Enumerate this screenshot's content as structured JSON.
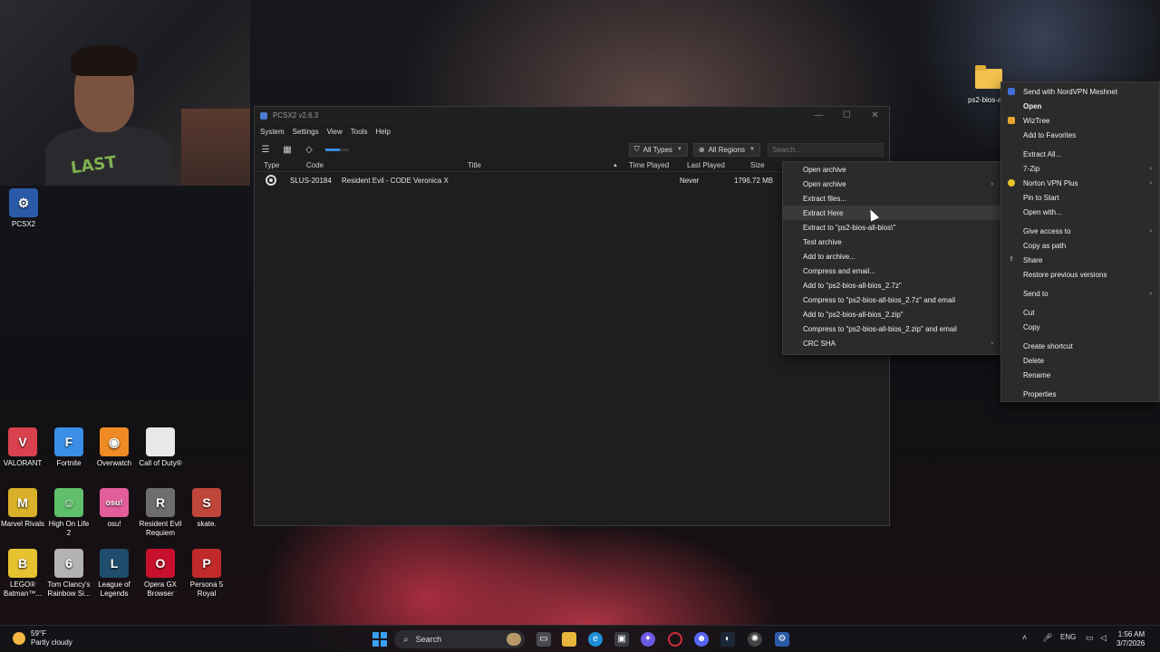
{
  "pcsx2": {
    "title": "PCSX2 v2.6.3",
    "menus": [
      "System",
      "Settings",
      "View",
      "Tools",
      "Help"
    ],
    "filters": {
      "types": "All Types",
      "regions": "All Regions",
      "search_placeholder": "Search..."
    },
    "columns": {
      "type": "Type",
      "code": "Code",
      "title": "Title",
      "time_played": "Time Played",
      "last_played": "Last Played",
      "size": "Size"
    },
    "games": [
      {
        "code": "SLUS-20184",
        "title": "Resident Evil - CODE Veronica X",
        "time_played": "",
        "last_played": "Never",
        "size": "1796.72 MB"
      }
    ]
  },
  "zip_menu": {
    "items": [
      {
        "label": "Open archive"
      },
      {
        "label": "Open archive",
        "submenu": true
      },
      {
        "label": "Extract files..."
      },
      {
        "label": "Extract Here"
      },
      {
        "label": "Extract to \"ps2-bios-all-bios\\\""
      },
      {
        "label": "Test archive"
      },
      {
        "label": "Add to archive..."
      },
      {
        "label": "Compress and email..."
      },
      {
        "label": "Add to \"ps2-bios-all-bios_2.7z\""
      },
      {
        "label": "Compress to \"ps2-bios-all-bios_2.7z\" and email"
      },
      {
        "label": "Add to \"ps2-bios-all-bios_2.zip\""
      },
      {
        "label": "Compress to \"ps2-bios-all-bios_2.zip\" and email"
      },
      {
        "label": "CRC SHA",
        "submenu": true
      }
    ]
  },
  "explorer_menu": {
    "items": [
      {
        "label": "Send with NordVPN Meshnet",
        "icon": "nordvpn-icon"
      },
      {
        "label": "Open",
        "bold": true
      },
      {
        "label": "WizTree",
        "icon": "wiztree-icon"
      },
      {
        "label": "Add to Favorites"
      },
      {
        "label": "Extract All..."
      },
      {
        "label": "7-Zip",
        "submenu": true
      },
      {
        "label": "Norton VPN Plus",
        "icon": "norton-icon",
        "submenu": true
      },
      {
        "label": "Pin to Start"
      },
      {
        "label": "Open with..."
      },
      {
        "label": "Give access to",
        "submenu": true
      },
      {
        "label": "Copy as path"
      },
      {
        "label": "Share",
        "icon": "share-icon"
      },
      {
        "label": "Restore previous versions"
      },
      {
        "label": "Send to",
        "submenu": true
      },
      {
        "label": "Cut"
      },
      {
        "label": "Copy"
      },
      {
        "label": "Create shortcut"
      },
      {
        "label": "Delete"
      },
      {
        "label": "Rename"
      },
      {
        "label": "Properties"
      }
    ]
  },
  "desktop": {
    "folder_label": "ps2-bios-a",
    "pcsx2_icon": "PCSX2",
    "icons": [
      {
        "label": "VALORANT",
        "color": "#d9414e",
        "glyph": "V"
      },
      {
        "label": "Fortnite",
        "color": "#3a8ee6",
        "glyph": "F"
      },
      {
        "label": "Overwatch",
        "color": "#f08a24",
        "glyph": "◉"
      },
      {
        "label": "Call of Duty®",
        "color": "#e8e8e8",
        "glyph": ""
      },
      {
        "label": "Marvel Rivals",
        "color": "#d8b02a",
        "glyph": "M"
      },
      {
        "label": "High On Life 2",
        "color": "#5fbf6b",
        "glyph": "☺"
      },
      {
        "label": "osu!",
        "color": "#e35d9b",
        "glyph": "osu!"
      },
      {
        "label": "Resident Evil Requiem",
        "color": "#6d6d6d",
        "glyph": "R"
      },
      {
        "label": "skate.",
        "color": "#c0453a",
        "glyph": "S"
      },
      {
        "label": "LEGO® Batman™...",
        "color": "#e7c230",
        "glyph": "B"
      },
      {
        "label": "Tom Clancy's Rainbow Si...",
        "color": "#b3b3b3",
        "glyph": "6"
      },
      {
        "label": "League of Legends",
        "color": "#1f4d6b",
        "glyph": "L"
      },
      {
        "label": "Opera GX Browser",
        "color": "#c8102e",
        "glyph": "O"
      },
      {
        "label": "Persona 5 Royal",
        "color": "#c02a2a",
        "glyph": "P"
      }
    ],
    "webcam_shirt": "LAST"
  },
  "taskbar": {
    "weather_temp": "59°F",
    "weather_desc": "Partly cloudy",
    "search_label": "Search",
    "language": "ENG",
    "time": "1:56 AM",
    "date": "3/7/2026"
  }
}
